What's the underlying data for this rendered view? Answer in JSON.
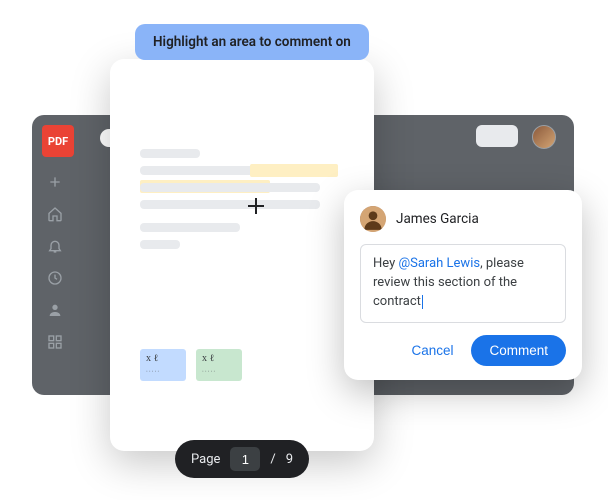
{
  "tooltip": {
    "text": "Highlight an area to comment on"
  },
  "pdf_badge": {
    "label": "PDF"
  },
  "sidebar": {
    "icons": [
      "plus-icon",
      "home-icon",
      "bell-icon",
      "clock-icon",
      "person-icon",
      "dashboard-icon"
    ]
  },
  "signatures": {
    "a": {
      "scribble": "x ℓ",
      "dots": "·····"
    },
    "b": {
      "scribble": "x ℓ",
      "dots": "·····"
    }
  },
  "pagination": {
    "label": "Page",
    "current": "1",
    "separator": "/",
    "total": "9"
  },
  "comment": {
    "author": "James Garcia",
    "text_prefix": "Hey ",
    "mention": "@Sarah Lewis",
    "text_suffix": ", please review this section of the contract",
    "cancel": "Cancel",
    "submit": "Comment"
  }
}
